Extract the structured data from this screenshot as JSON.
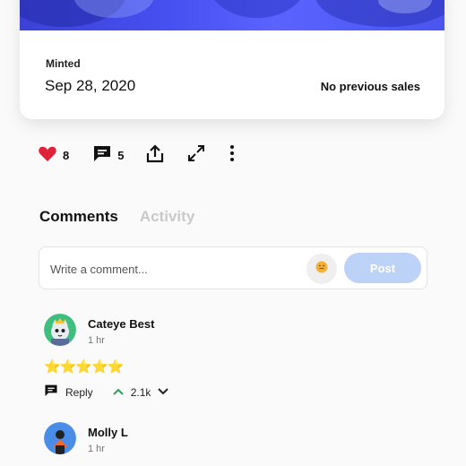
{
  "nft_card": {
    "minted_label": "Minted",
    "minted_date": "Sep 28, 2020",
    "sales_status": "No previous sales"
  },
  "actions": {
    "likes": "8",
    "comments": "5",
    "icons": [
      "heart-icon",
      "comment-icon",
      "share-icon",
      "expand-icon",
      "more-icon"
    ]
  },
  "tabs": [
    {
      "label": "Comments",
      "active": true
    },
    {
      "label": "Activity",
      "active": false
    }
  ],
  "comment_input": {
    "placeholder": "Write a comment...",
    "post_label": "Post"
  },
  "comments": [
    {
      "author": "Cateye Best",
      "time": "1 hr",
      "body": "⭐⭐⭐⭐⭐",
      "reply_label": "Reply",
      "votes": "2.1k"
    },
    {
      "author": "Molly L",
      "time": "1 hr"
    }
  ],
  "colors": {
    "accent_heart": "#e0223b",
    "post_button": "#bcd2f6",
    "upvote": "#2e9b5f",
    "artwork_blue": "#4650f0"
  }
}
